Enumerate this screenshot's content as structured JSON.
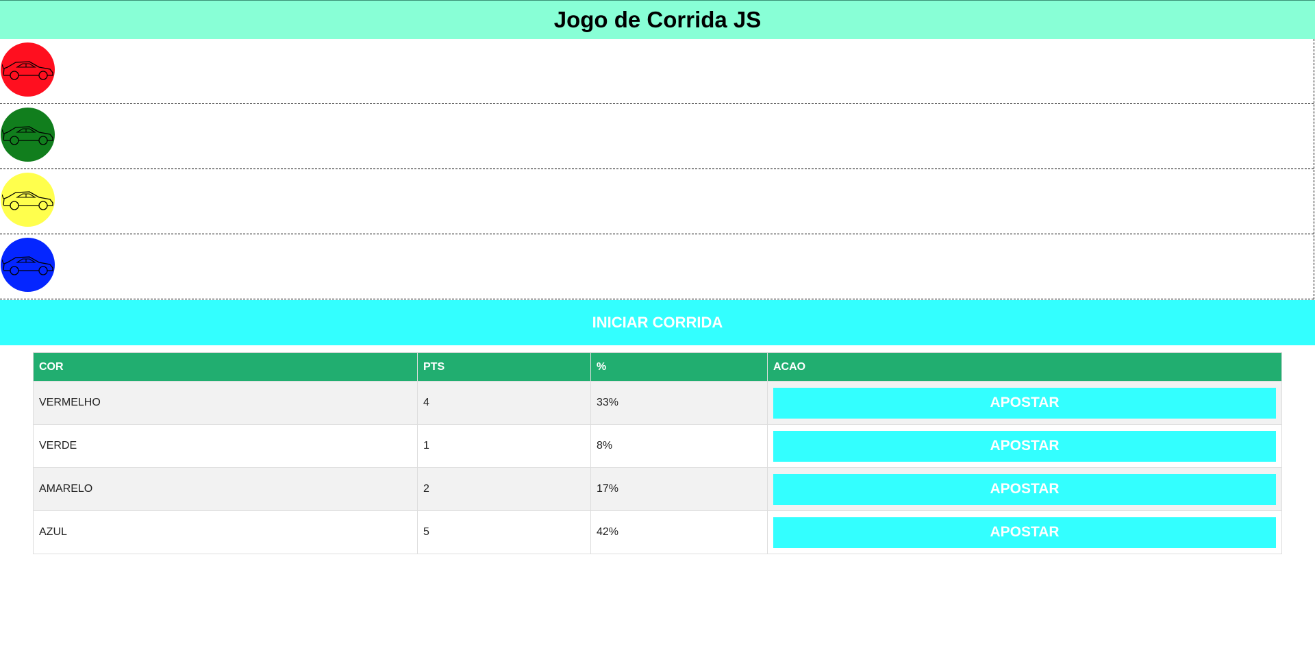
{
  "header": {
    "title": "Jogo de Corrida JS"
  },
  "track": {
    "cars": [
      {
        "name": "red-car",
        "color": "#ff0f1f"
      },
      {
        "name": "green-car",
        "color": "#117e1d"
      },
      {
        "name": "yellow-car",
        "color": "#ffff4d"
      },
      {
        "name": "blue-car",
        "color": "#0526ff"
      }
    ]
  },
  "start_button": {
    "label": "INICIAR CORRIDA"
  },
  "table": {
    "headers": [
      "COR",
      "PTS",
      "%",
      "ACAO"
    ],
    "rows": [
      {
        "cor": "VERMELHO",
        "pts": "4",
        "pct": "33%",
        "action": "APOSTAR"
      },
      {
        "cor": "VERDE",
        "pts": "1",
        "pct": "8%",
        "action": "APOSTAR"
      },
      {
        "cor": "AMARELO",
        "pts": "2",
        "pct": "17%",
        "action": "APOSTAR"
      },
      {
        "cor": "AZUL",
        "pts": "5",
        "pct": "42%",
        "action": "APOSTAR"
      }
    ]
  },
  "colors": {
    "header_bg": "#88ffd6",
    "button_bg": "#33ffff",
    "table_header_bg": "#21ae70"
  }
}
